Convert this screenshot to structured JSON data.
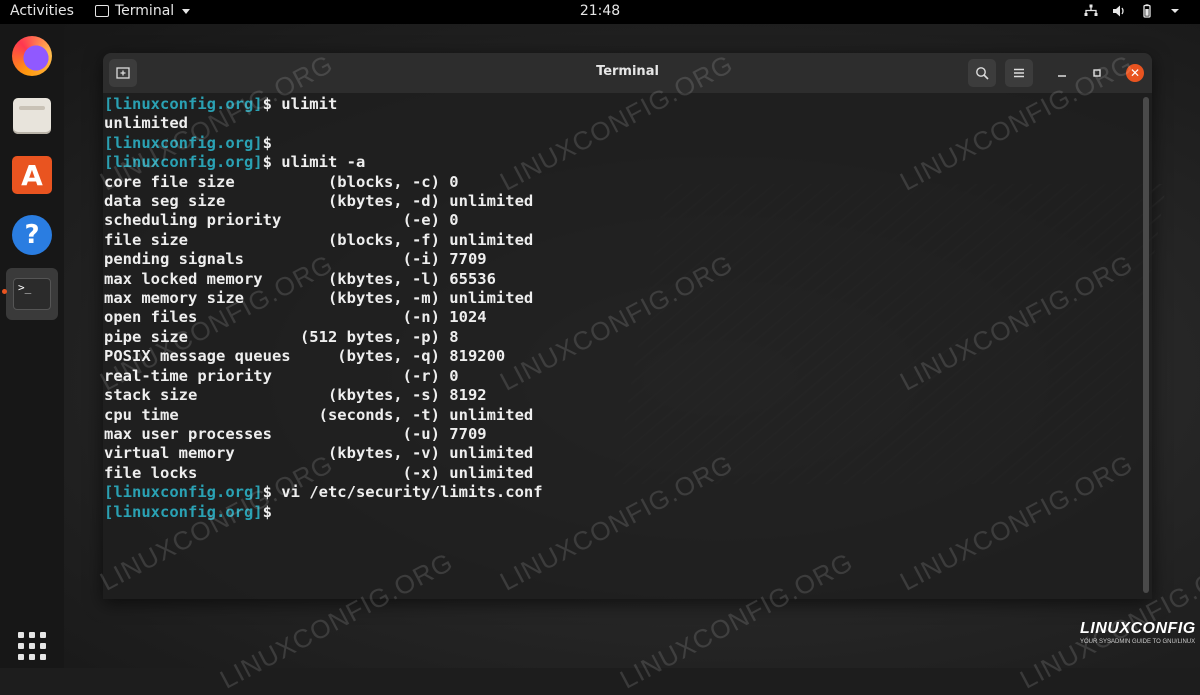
{
  "topbar": {
    "activities": "Activities",
    "app_name": "Terminal",
    "clock": "21:48",
    "tray_icons": [
      "network-icon",
      "volume-icon",
      "battery-icon",
      "power-caret-icon"
    ]
  },
  "dock": {
    "items": [
      "firefox-icon",
      "files-icon",
      "app-store-icon",
      "help-icon",
      "terminal-icon"
    ],
    "active": "terminal-icon",
    "show_apps": "show-applications-icon"
  },
  "window": {
    "title": "Terminal"
  },
  "terminal": {
    "lines": [
      {
        "prompt": "[linuxconfig.org]",
        "text": "$ ulimit"
      },
      {
        "prompt": "",
        "text": "unlimited"
      },
      {
        "prompt": "[linuxconfig.org]",
        "text": "$"
      },
      {
        "prompt": "[linuxconfig.org]",
        "text": "$ ulimit -a"
      },
      {
        "prompt": "",
        "text": "core file size          (blocks, -c) 0"
      },
      {
        "prompt": "",
        "text": "data seg size           (kbytes, -d) unlimited"
      },
      {
        "prompt": "",
        "text": "scheduling priority             (-e) 0"
      },
      {
        "prompt": "",
        "text": "file size               (blocks, -f) unlimited"
      },
      {
        "prompt": "",
        "text": "pending signals                 (-i) 7709"
      },
      {
        "prompt": "",
        "text": "max locked memory       (kbytes, -l) 65536"
      },
      {
        "prompt": "",
        "text": "max memory size         (kbytes, -m) unlimited"
      },
      {
        "prompt": "",
        "text": "open files                      (-n) 1024"
      },
      {
        "prompt": "",
        "text": "pipe size            (512 bytes, -p) 8"
      },
      {
        "prompt": "",
        "text": "POSIX message queues     (bytes, -q) 819200"
      },
      {
        "prompt": "",
        "text": "real-time priority              (-r) 0"
      },
      {
        "prompt": "",
        "text": "stack size              (kbytes, -s) 8192"
      },
      {
        "prompt": "",
        "text": "cpu time               (seconds, -t) unlimited"
      },
      {
        "prompt": "",
        "text": "max user processes              (-u) 7709"
      },
      {
        "prompt": "",
        "text": "virtual memory          (kbytes, -v) unlimited"
      },
      {
        "prompt": "",
        "text": "file locks                      (-x) unlimited"
      },
      {
        "prompt": "[linuxconfig.org]",
        "text": "$ vi /etc/security/limits.conf"
      },
      {
        "prompt": "[linuxconfig.org]",
        "text": "$"
      }
    ]
  },
  "watermark": "LINUXCONFIG.ORG",
  "logo": {
    "name": "LINUXCONFIG",
    "tagline": "YOUR SYSADMIN GUIDE TO GNU/LINUX"
  }
}
